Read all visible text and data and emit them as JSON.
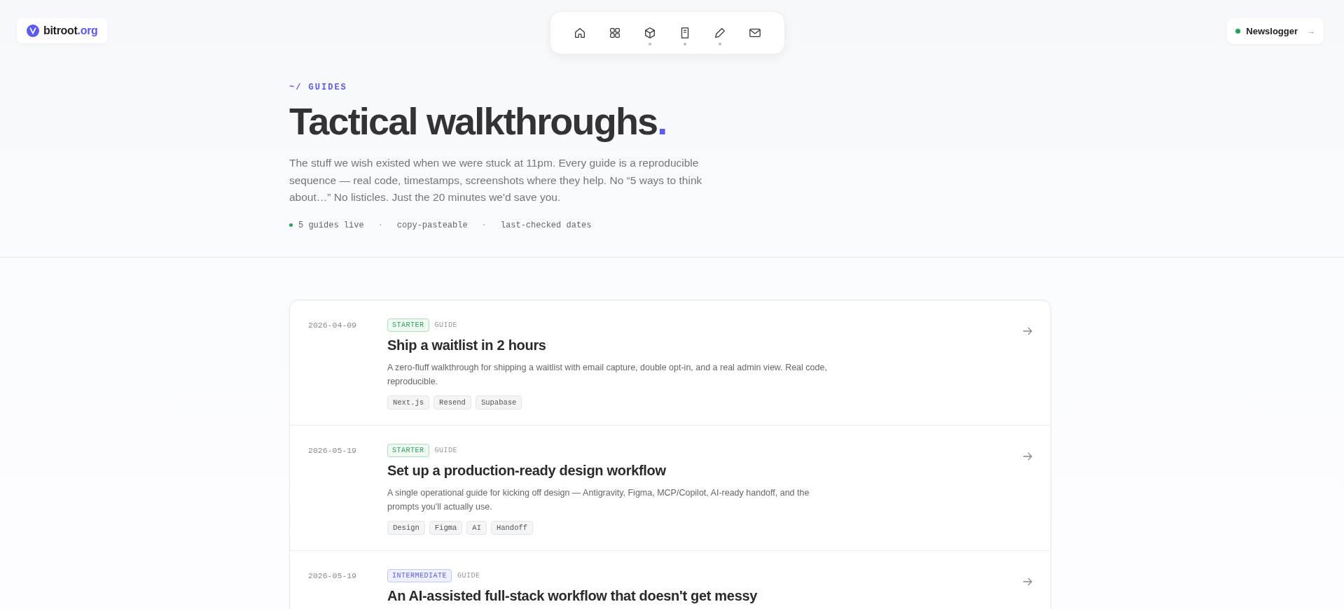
{
  "logo": {
    "text": "bitroot",
    "tld": ".org"
  },
  "nav": [
    {
      "kind": "home",
      "dot": false
    },
    {
      "kind": "grid",
      "dot": false
    },
    {
      "kind": "cube",
      "dot": true
    },
    {
      "kind": "document",
      "dot": true
    },
    {
      "kind": "pencil",
      "dot": true
    },
    {
      "kind": "mail",
      "dot": false
    }
  ],
  "newsletter": {
    "label": "Newslogger",
    "arrow": "→"
  },
  "hero": {
    "eyebrow": "~/ GUIDES",
    "title": "Tactical walkthroughs",
    "title_dot": ".",
    "description": "The stuff we wish existed when we were stuck at 11pm. Every guide is a reproducible sequence — real code, timestamps, screenshots where they help. No “5 ways to think about…” No listicles. Just the 20 minutes we'd save you.",
    "meta": [
      "5 guides live",
      "copy-pasteable",
      "last-checked dates"
    ],
    "separator": "·"
  },
  "guides": [
    {
      "date": "2026-04-09",
      "level": {
        "kind": "starter",
        "label": "STARTER"
      },
      "type": "GUIDE",
      "title": "Ship a waitlist in 2 hours",
      "description": "A zero-fluff walkthrough for shipping a waitlist with email capture, double opt-in, and a real admin view. Real code, reproducible.",
      "tags": [
        "Next.js",
        "Resend",
        "Supabase"
      ]
    },
    {
      "date": "2026-05-19",
      "level": {
        "kind": "starter",
        "label": "STARTER"
      },
      "type": "GUIDE",
      "title": "Set up a production-ready design workflow",
      "description": "A single operational guide for kicking off design — Antigravity, Figma, MCP/Copilot, AI-ready handoff, and the prompts you'll actually use.",
      "tags": [
        "Design",
        "Figma",
        "AI",
        "Handoff"
      ]
    },
    {
      "date": "2026-05-19",
      "level": {
        "kind": "intermediate",
        "label": "INTERMEDIATE"
      },
      "type": "GUIDE",
      "title": "An AI-assisted full-stack workflow that doesn't get messy"
    }
  ]
}
